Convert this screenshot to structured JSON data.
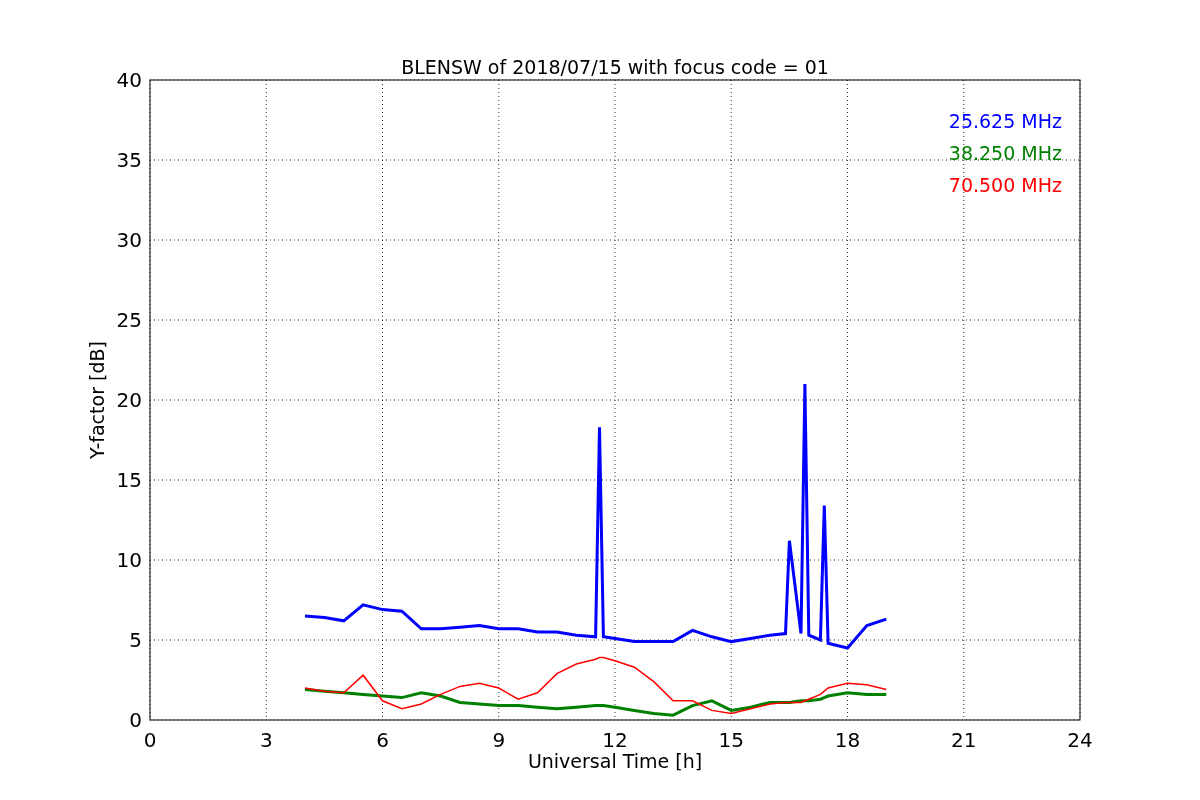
{
  "figure": {
    "chart_data": {
      "type": "line",
      "title": "BLENSW of 2018/07/15 with focus code = 01",
      "xlabel": "Universal Time [h]",
      "ylabel": "Y-factor [dB]",
      "x": [
        4,
        4.5,
        5,
        5.5,
        6,
        6.5,
        7,
        7.5,
        8,
        8.5,
        9,
        9.5,
        10,
        10.5,
        11,
        11.5,
        11.6,
        11.7,
        12,
        12.5,
        13,
        13.5,
        14,
        14.5,
        15,
        15.5,
        16,
        16.4,
        16.5,
        16.8,
        16.9,
        17,
        17.3,
        17.4,
        17.5,
        18,
        18.5,
        19
      ],
      "series": [
        {
          "name": "25.625 MHz",
          "color": "#0000ff",
          "values": [
            6.5,
            6.4,
            6.2,
            7.2,
            6.9,
            6.8,
            5.7,
            5.7,
            5.8,
            5.9,
            5.7,
            5.7,
            5.5,
            5.5,
            5.3,
            5.2,
            18.3,
            5.2,
            5.1,
            4.9,
            4.9,
            4.9,
            5.6,
            5.2,
            4.9,
            5.1,
            5.3,
            5.4,
            11.2,
            5.4,
            21.0,
            5.3,
            5.0,
            13.4,
            4.8,
            4.5,
            5.9,
            6.3
          ]
        },
        {
          "name": "38.250 MHz",
          "color": "#008000",
          "values": [
            1.9,
            1.8,
            1.7,
            1.6,
            1.5,
            1.4,
            1.7,
            1.5,
            1.1,
            1.0,
            0.9,
            0.9,
            0.8,
            0.7,
            0.8,
            0.9,
            0.9,
            0.9,
            0.8,
            0.6,
            0.4,
            0.3,
            0.9,
            1.2,
            0.6,
            0.8,
            1.1,
            1.1,
            1.1,
            1.2,
            1.2,
            1.2,
            1.3,
            1.4,
            1.5,
            1.7,
            1.6,
            1.6
          ]
        },
        {
          "name": "70.500 MHz",
          "color": "#ff0000",
          "values": [
            2.0,
            1.8,
            1.7,
            2.8,
            1.2,
            0.7,
            1.0,
            1.6,
            2.1,
            2.3,
            2.0,
            1.3,
            1.7,
            2.9,
            3.5,
            3.8,
            3.9,
            3.9,
            3.7,
            3.3,
            2.4,
            1.2,
            1.2,
            0.6,
            0.4,
            0.7,
            1.0,
            1.1,
            1.1,
            1.1,
            1.2,
            1.3,
            1.6,
            1.8,
            2.0,
            2.3,
            2.2,
            1.9
          ]
        }
      ],
      "xlim": [
        0,
        24
      ],
      "ylim": [
        0,
        40
      ],
      "xticks": [
        0,
        3,
        6,
        9,
        12,
        15,
        18,
        21,
        24
      ],
      "yticks": [
        0,
        5,
        10,
        15,
        20,
        25,
        30,
        35,
        40
      ],
      "grid": true
    }
  }
}
